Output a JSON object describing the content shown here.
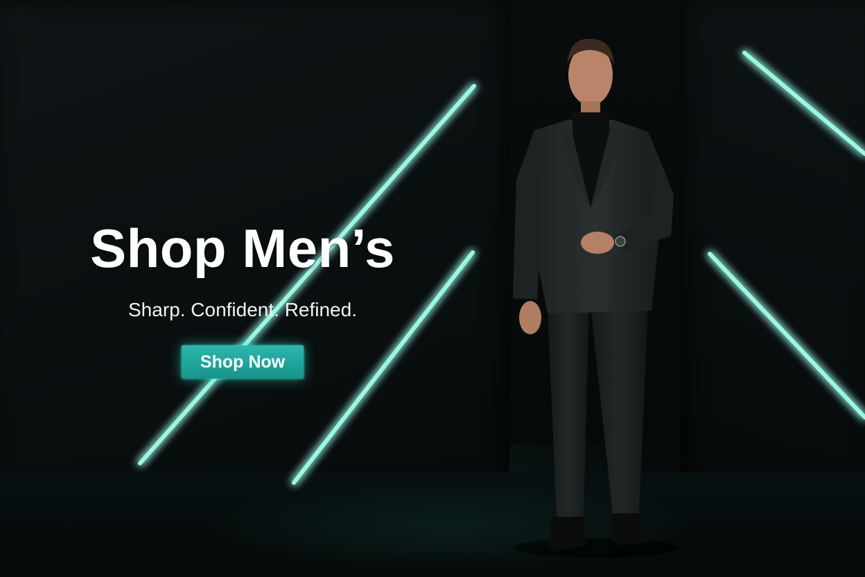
{
  "hero": {
    "title": "Shop Men’s",
    "subtitle": "Sharp. Confident. Refined.",
    "cta_label": "Shop Now"
  },
  "colors": {
    "accent": "#2ab8ad",
    "neon": "#8ff5e3",
    "background": "#070b0c"
  },
  "imagery": {
    "model": "man in dark charcoal suit with black turtleneck and wristwatch"
  }
}
